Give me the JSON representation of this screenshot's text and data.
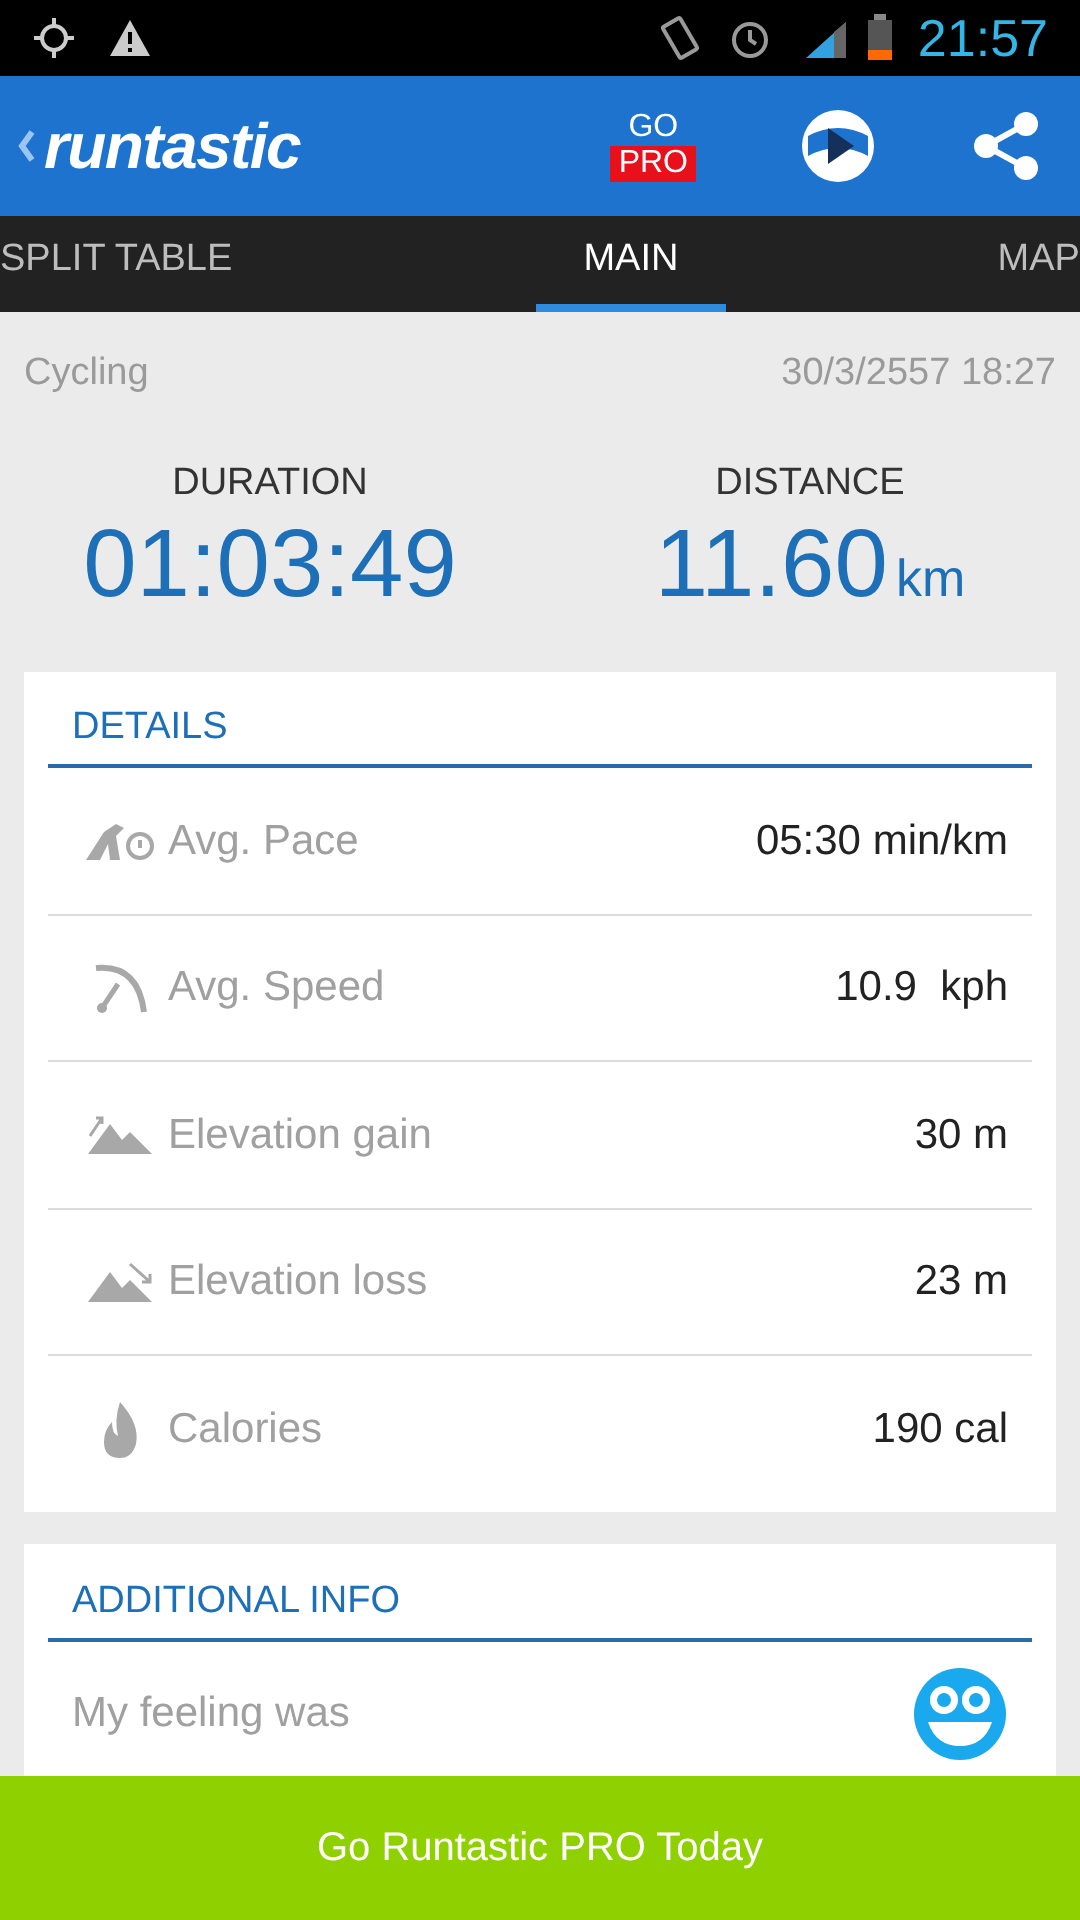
{
  "status_bar": {
    "time": "21:57"
  },
  "app_bar": {
    "logo": "runtastic",
    "go_pro": {
      "top": "GO",
      "bottom": "PRO"
    }
  },
  "tabs": [
    {
      "label": "SPLIT TABLE",
      "selected": false
    },
    {
      "label": "MAIN",
      "selected": true
    },
    {
      "label": "MAP",
      "selected": false
    }
  ],
  "activity": {
    "sport": "Cycling",
    "date": "30/3/2557 18:27"
  },
  "summary": [
    {
      "label": "DURATION",
      "value": "01:03:49"
    },
    {
      "label": "DISTANCE",
      "value": "11.60",
      "unit": "km"
    }
  ],
  "details": {
    "title": "DETAILS",
    "rows": [
      {
        "kind": "pace",
        "label": "Avg. Pace",
        "value": "05:30 min/km"
      },
      {
        "kind": "speed",
        "label": "Avg. Speed",
        "value": "10.9  kph"
      },
      {
        "kind": "gain",
        "label": "Elevation gain",
        "value": "30 m"
      },
      {
        "kind": "loss",
        "label": "Elevation loss",
        "value": "23 m"
      },
      {
        "kind": "calories",
        "label": "Calories",
        "value": "190 cal"
      }
    ]
  },
  "additional_info": {
    "title": "ADDITIONAL INFO",
    "feeling_label": "My feeling was"
  },
  "banner": "Go Runtastic PRO Today"
}
